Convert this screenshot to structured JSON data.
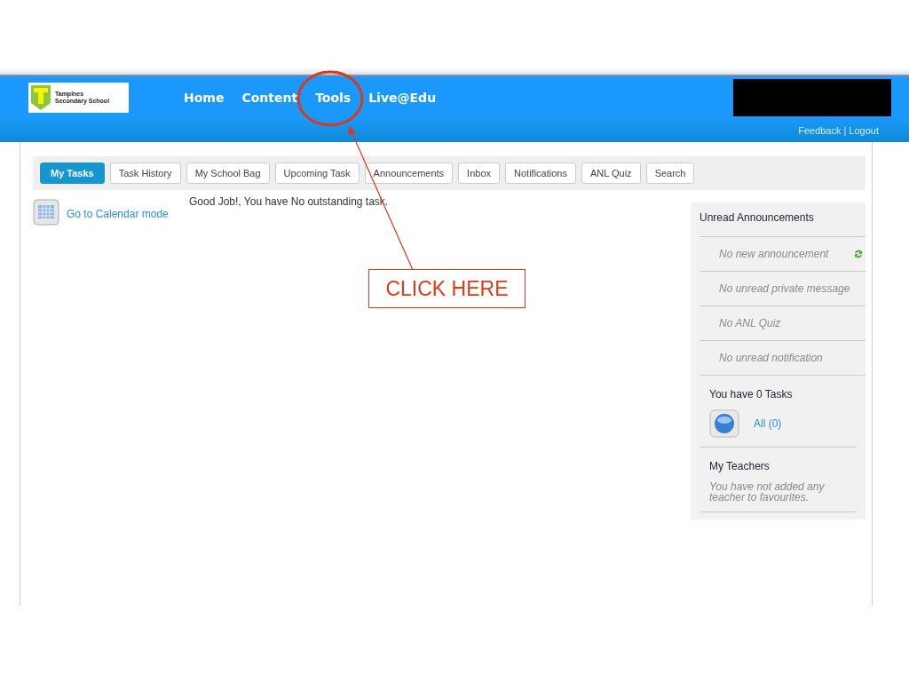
{
  "header": {
    "logo_text": [
      "Tampines",
      "Secondary School"
    ],
    "nav": [
      "Home",
      "Content",
      "Tools",
      "Live@Edu"
    ],
    "links": [
      "Feedback",
      "|",
      "Logout"
    ]
  },
  "tabs": [
    {
      "label": "My Tasks",
      "selected": true
    },
    {
      "label": "Task History",
      "selected": false
    },
    {
      "label": "My School Bag",
      "selected": false
    },
    {
      "label": "Upcoming Task",
      "selected": false
    },
    {
      "label": "Announcements",
      "selected": false
    },
    {
      "label": "Inbox",
      "selected": false
    },
    {
      "label": "Notifications",
      "selected": false
    },
    {
      "label": "ANL Quiz",
      "selected": false
    },
    {
      "label": "Search",
      "selected": false
    }
  ],
  "calendar_link": "Go to Calendar mode",
  "message": "Good Job!, You have No outstanding task.",
  "sidebar": {
    "title": "Unread Announcements",
    "items": [
      {
        "text": "No new announcement",
        "refresh": true
      },
      {
        "text": "No unread private message",
        "refresh": false
      },
      {
        "text": "No ANL Quiz",
        "refresh": false
      },
      {
        "text": "No unread notification",
        "refresh": false
      }
    ],
    "tasks_title": "You have 0 Tasks",
    "tasks_link": "All (0)",
    "teachers_title": "My Teachers",
    "teachers_note": "You have not added any teacher to favourites."
  },
  "annotation": {
    "label": "CLICK HERE"
  }
}
